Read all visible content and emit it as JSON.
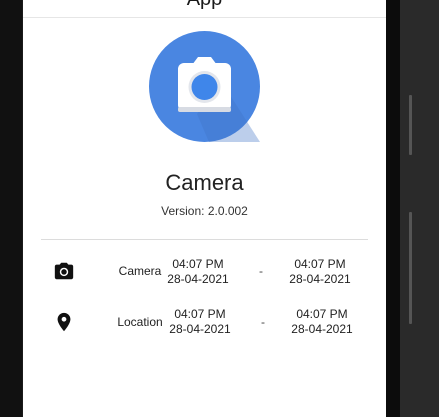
{
  "app": {
    "title": "App",
    "name": "Camera",
    "version": "Version: 2.0.002"
  },
  "permissions": [
    {
      "icon": "camera-icon",
      "label": "Camera",
      "start_time": "04:07 PM",
      "start_date": "28-04-2021",
      "separator": "-",
      "end_time": "04:07 PM",
      "end_date": "28-04-2021"
    },
    {
      "icon": "location-pin-icon",
      "label": "Location",
      "start_time": "04:07 PM",
      "start_date": "28-04-2021",
      "separator": "-",
      "end_time": "04:07 PM",
      "end_date": "28-04-2021"
    }
  ],
  "colors": {
    "logo_background": "#4a86e1",
    "logo_body": "#ffffff",
    "logo_lens": "#3f86ea"
  }
}
